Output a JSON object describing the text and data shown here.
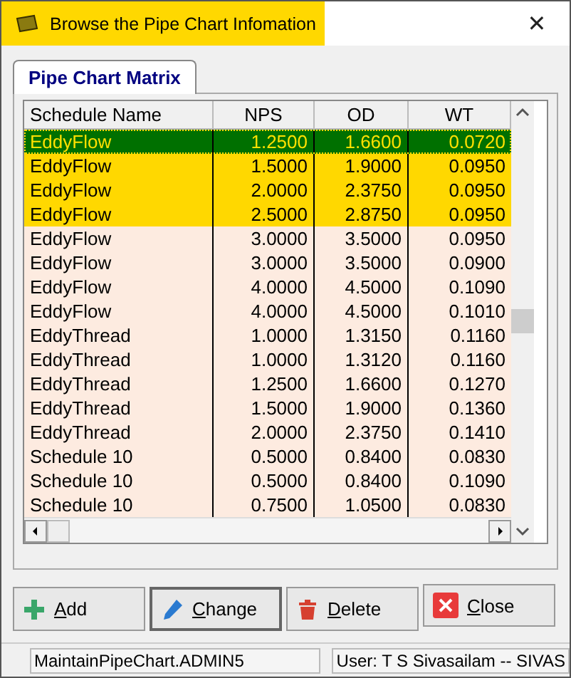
{
  "window": {
    "title": "Browse the Pipe Chart Infomation",
    "close": "✕"
  },
  "tabs": [
    {
      "label": "Pipe Chart Matrix",
      "selected": true
    }
  ],
  "table": {
    "columns": [
      "Schedule Name",
      "NPS",
      "OD",
      "WT"
    ],
    "rows": [
      {
        "cells": [
          "EddyFlow",
          "1.2500",
          "1.6600",
          "0.0720"
        ],
        "selected": true,
        "marked": true
      },
      {
        "cells": [
          "EddyFlow",
          "1.5000",
          "1.9000",
          "0.0950"
        ],
        "selected": false,
        "marked": true
      },
      {
        "cells": [
          "EddyFlow",
          "2.0000",
          "2.3750",
          "0.0950"
        ],
        "selected": false,
        "marked": true
      },
      {
        "cells": [
          "EddyFlow",
          "2.5000",
          "2.8750",
          "0.0950"
        ],
        "selected": false,
        "marked": true
      },
      {
        "cells": [
          "EddyFlow",
          "3.0000",
          "3.5000",
          "0.0950"
        ],
        "selected": false,
        "marked": false
      },
      {
        "cells": [
          "EddyFlow",
          "3.0000",
          "3.5000",
          "0.0900"
        ],
        "selected": false,
        "marked": false
      },
      {
        "cells": [
          "EddyFlow",
          "4.0000",
          "4.5000",
          "0.1090"
        ],
        "selected": false,
        "marked": false
      },
      {
        "cells": [
          "EddyFlow",
          "4.0000",
          "4.5000",
          "0.1010"
        ],
        "selected": false,
        "marked": false
      },
      {
        "cells": [
          "EddyThread",
          "1.0000",
          "1.3150",
          "0.1160"
        ],
        "selected": false,
        "marked": false
      },
      {
        "cells": [
          "EddyThread",
          "1.0000",
          "1.3120",
          "0.1160"
        ],
        "selected": false,
        "marked": false
      },
      {
        "cells": [
          "EddyThread",
          "1.2500",
          "1.6600",
          "0.1270"
        ],
        "selected": false,
        "marked": false
      },
      {
        "cells": [
          "EddyThread",
          "1.5000",
          "1.9000",
          "0.1360"
        ],
        "selected": false,
        "marked": false
      },
      {
        "cells": [
          "EddyThread",
          "2.0000",
          "2.3750",
          "0.1410"
        ],
        "selected": false,
        "marked": false
      },
      {
        "cells": [
          "Schedule 10",
          "0.5000",
          "0.8400",
          "0.0830"
        ],
        "selected": false,
        "marked": false
      },
      {
        "cells": [
          "Schedule 10",
          "0.5000",
          "0.8400",
          "0.1090"
        ],
        "selected": false,
        "marked": false
      },
      {
        "cells": [
          "Schedule 10",
          "0.7500",
          "1.0500",
          "0.0830"
        ],
        "selected": false,
        "marked": false
      }
    ]
  },
  "buttons": [
    {
      "label": "Add",
      "kind": "add"
    },
    {
      "label": "Change",
      "kind": "change"
    },
    {
      "label": "Delete",
      "kind": "delete"
    },
    {
      "label": "Close",
      "kind": "close"
    }
  ],
  "status_bar": [
    "MaintainPipeChart.ADMIN5",
    "User: T S Sivasailam -- SIVAS"
  ]
}
